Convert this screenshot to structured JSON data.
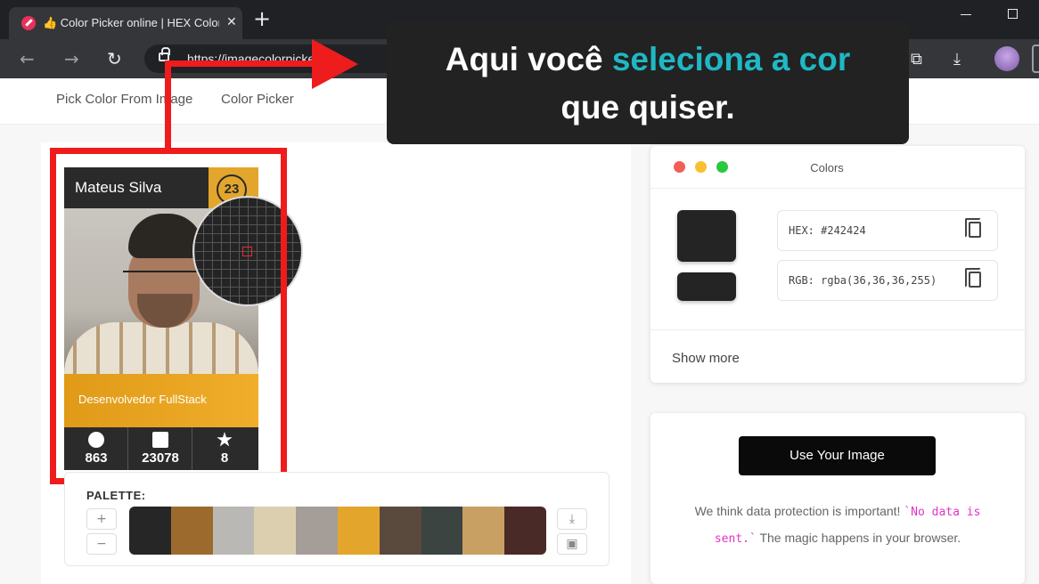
{
  "browser": {
    "tab_title": "👍 Color Picker online | HEX Color",
    "tab_close": "✕",
    "new_tab": "+",
    "url": "https://imagecolorpicker.com"
  },
  "site_nav": {
    "items": [
      {
        "label": "Pick Color From Image"
      },
      {
        "label": "Color Picker"
      }
    ]
  },
  "callout": {
    "prefix": "Aqui você ",
    "highlight": "seleciona a cor",
    "line2": "que quiser.",
    "highlight_color": "#1fb8c4"
  },
  "card": {
    "name": "Mateus Silva",
    "level": "23",
    "role": "Desenvolvedor FullStack",
    "stats": [
      {
        "icon": "check-circle-icon",
        "value": "863"
      },
      {
        "icon": "chart-icon",
        "value": "23078"
      },
      {
        "icon": "badge-star-icon",
        "value": "8"
      }
    ]
  },
  "palette": {
    "label": "PALETTE:",
    "add": "+",
    "remove": "−",
    "download": "⤓",
    "save": "▣",
    "colors": [
      "#262626",
      "#9d6a2e",
      "#b9b8b4",
      "#dccfb0",
      "#a49d98",
      "#e4a52c",
      "#5a4a3e",
      "#3b4440",
      "#c9a063",
      "#4a2a26"
    ]
  },
  "colors_panel": {
    "title": "Colors",
    "window_dots": [
      "#f25f58",
      "#fbbe2f",
      "#2ac840"
    ],
    "selected_color": "#242424",
    "hex_label": "HEX: #242424",
    "rgb_label": "RGB: rgba(36,36,36,255)",
    "show_more": "Show more"
  },
  "upload": {
    "button": "Use Your Image",
    "text_before": "We think data protection is important! ",
    "code": "`No data is sent.`",
    "text_after": " The magic happens in your browser."
  }
}
